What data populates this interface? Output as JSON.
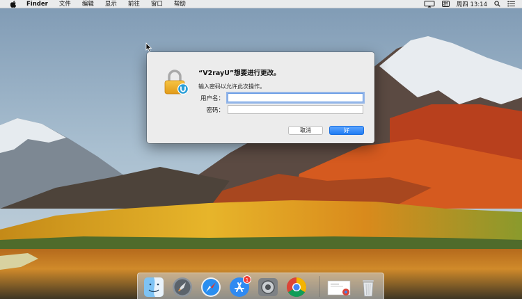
{
  "menubar": {
    "app_name": "Finder",
    "menus": [
      "文件",
      "编辑",
      "显示",
      "前往",
      "窗口",
      "帮助"
    ],
    "input_method": "拼",
    "clock": "周四 13:14"
  },
  "dialog": {
    "title": "“V2rayU”想要进行更改。",
    "message": "输入密码以允许此次操作。",
    "username_label": "用户名：",
    "username_value": "",
    "password_label": "密码：",
    "password_value": "",
    "cancel_label": "取消",
    "ok_label": "好"
  },
  "dock": {
    "items": [
      "Finder",
      "Launchpad",
      "Safari",
      "App Store",
      "System Preferences",
      "Google Chrome",
      "Document",
      "Trash"
    ],
    "app_store_badge": "1"
  },
  "colors": {
    "accent": "#1f7cf4",
    "badge": "#ef3b35"
  }
}
